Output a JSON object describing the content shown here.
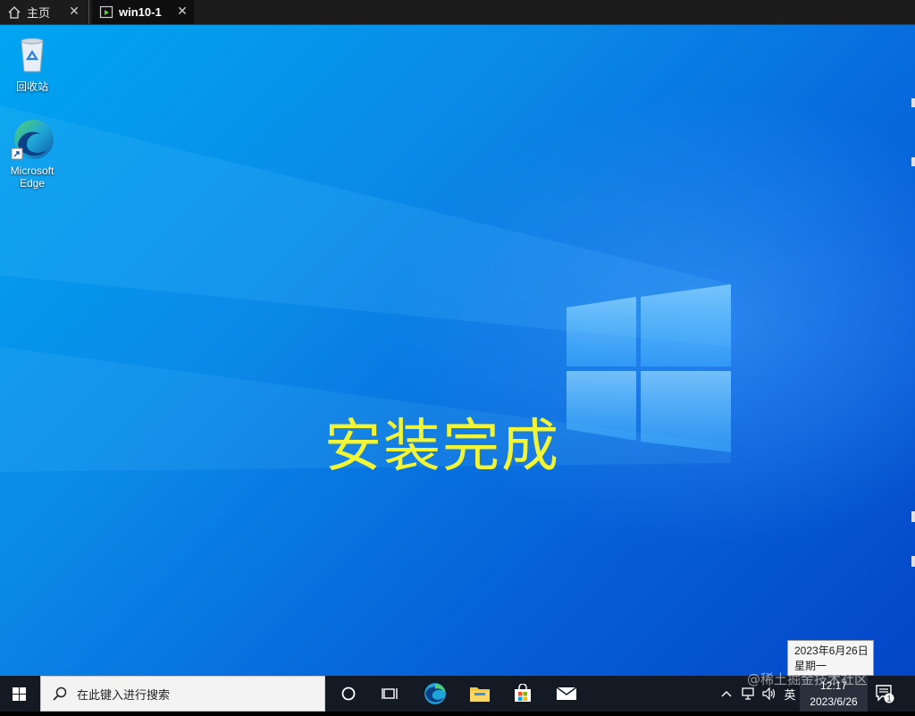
{
  "tabs": {
    "home_label": "主页",
    "vm_label": "win10-1"
  },
  "desktop": {
    "icons": [
      {
        "label": "回收站",
        "icon": "recycle-bin-icon"
      },
      {
        "label_line1": "Microsoft",
        "label_line2": "Edge",
        "icon": "edge-icon"
      }
    ],
    "overlay_text": "安装完成"
  },
  "tooltip": {
    "line1": "2023年6月26日",
    "line2": "星期一"
  },
  "taskbar": {
    "search_placeholder": "在此键入进行搜索",
    "ime_label": "英",
    "time": "12:17",
    "date": "2023/6/26",
    "notification_count": "1"
  },
  "watermark": "@稀土掘金技术社区",
  "colors": {
    "overlay_text": "#f2f533",
    "taskbar": "#131a24",
    "desktop_blue": "#0a8ae8"
  }
}
